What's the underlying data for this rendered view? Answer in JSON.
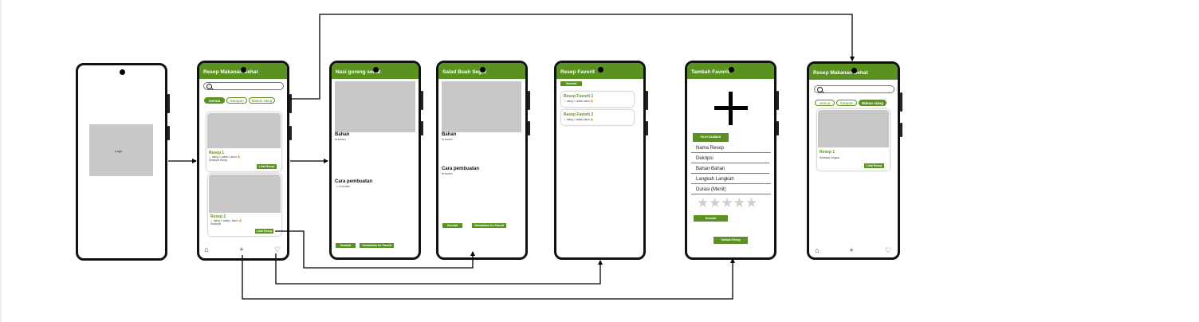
{
  "screens": {
    "splash": {
      "logo": "Logo"
    },
    "home": {
      "title": "Resep Makanan Sehat",
      "chips": [
        "semua",
        "Sarapan",
        "Makan siang"
      ],
      "recipes": [
        {
          "title": "Resep 1",
          "meta": "☆ rating ⏱ waktu / kalori 🔥",
          "desc": "Deskripsi Resep",
          "btn": "Lihat Resep"
        },
        {
          "title": "Resep 2",
          "meta": "☆ rating ⏱ waktu / kalori 🔥",
          "desc": "Deskripsi",
          "btn": "Lihat Resep"
        }
      ],
      "nav": {
        "home": "⌂",
        "add": "+",
        "fav": "♡"
      }
    },
    "detail1": {
      "title": "Nasi goreng sehat",
      "bahan": "Bahan",
      "bahan_sub": "isi konten",
      "cara": "Cara pembuatan",
      "cara_sub": "1. isi konten",
      "btn_back": "Kembali",
      "btn_fav": "Tambahkan Ke Favorit"
    },
    "detail2": {
      "title": "Salad Buah Segar",
      "bahan": "Bahan",
      "bahan_sub": "isi konten",
      "cara": "Cara pembuatan",
      "cara_sub": "isi konten",
      "btn_back": "Kembali",
      "btn_fav": "Tambahkan Ke Favorit"
    },
    "favorites": {
      "title": "Resep Favorit",
      "btn_back": "Kembali",
      "items": [
        {
          "title": "Resep Favorit 1",
          "meta": "☆ rating ⏱ waktu kalori 🔥"
        },
        {
          "title": "Resep Favorit 2",
          "meta": "☆ rating ⏱ waktu kalori 🔥"
        }
      ]
    },
    "add": {
      "title": "Tambah Favorit",
      "btn_image": "PILIH GAMBAR",
      "fields": [
        "Nama Resep",
        "Dekripsi",
        "Bahan Bahan",
        "Langkah Langkah",
        "Durasi (Menit)"
      ],
      "stars": "★★★★★",
      "btn_back": "Kembali",
      "btn_submit": "Tambah Resep"
    },
    "home2": {
      "title": "Resep Makanan Sehat",
      "chips": [
        "semua",
        "Sarapan",
        "Makan siang"
      ],
      "recipe": {
        "title": "Resep 1",
        "desc": "Deskripsi Singkat",
        "btn": "Lihat Resep"
      },
      "nav": {
        "home": "⌂",
        "add": "+",
        "fav": "♡"
      }
    }
  },
  "colors": {
    "accent": "#5a9220",
    "placeholder": "#c8c8c8",
    "frame": "#111111"
  }
}
